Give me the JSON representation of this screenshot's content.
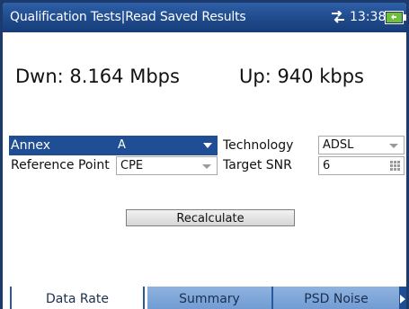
{
  "titlebar": {
    "title": "Qualification Tests|Read Saved Results",
    "time": "13:38",
    "icons": [
      "network-arrows-icon",
      "battery-icon"
    ]
  },
  "rates": {
    "down": "Dwn: 8.164 Mbps",
    "up": "Up: 940 kbps"
  },
  "form": {
    "annex_label": "Annex",
    "annex_value": "A",
    "reference_point_label": "Reference Point",
    "reference_point_value": "CPE",
    "technology_label": "Technology",
    "technology_value": "ADSL",
    "target_snr_label": "Target SNR",
    "target_snr_value": "6"
  },
  "buttons": {
    "recalculate": "Recalculate"
  },
  "tabs": [
    {
      "label": "Data Rate",
      "active": true
    },
    {
      "label": "Summary",
      "active": false
    },
    {
      "label": "PSD Noise",
      "active": false
    }
  ],
  "colors": {
    "titlebar": "#1f4a8c",
    "selected_row": "#1f4e95",
    "inactive_tab": "#7ea6d8"
  }
}
